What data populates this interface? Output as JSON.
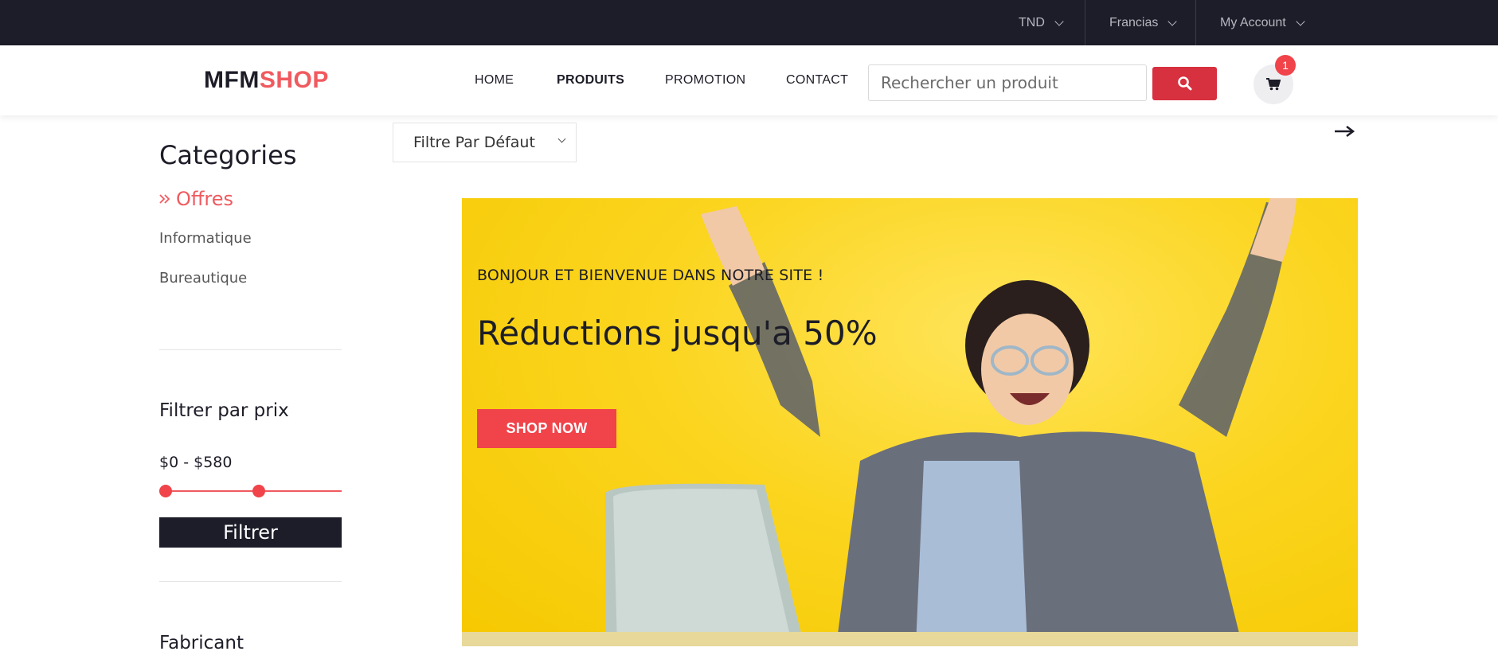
{
  "topbar": {
    "currency": "TND",
    "language": "Francias",
    "account": "My Account"
  },
  "header": {
    "logo_part1": "MFM",
    "logo_part2": "SHOP",
    "nav": [
      "HOME",
      "PRODUITS",
      "PROMOTION",
      "CONTACT"
    ],
    "active_nav": "PRODUITS",
    "search_placeholder": "Rechercher un produit",
    "cart_count": "1"
  },
  "sidebar": {
    "categories_title": "Categories",
    "active_category": "Offres",
    "categories": [
      "Informatique",
      "Bureautique"
    ],
    "price_title": "Filtrer par prix",
    "price_range": "$0 - $580",
    "price_min_fraction": 0.0,
    "price_max_fraction": 0.55,
    "filter_button": "Filtrer",
    "manufacturer_title": "Fabricant"
  },
  "sort": {
    "selected": "Filtre Par Défaut"
  },
  "hero": {
    "subtitle": "BONJOUR ET BIENVENUE DANS NOTRE SITE !",
    "headline": "Réductions jusqu'a 50%",
    "button": "SHOP NOW"
  },
  "colors": {
    "accent": "#f05a5f",
    "dark": "#1c1d29",
    "hero_bg": "#fbd51f"
  }
}
